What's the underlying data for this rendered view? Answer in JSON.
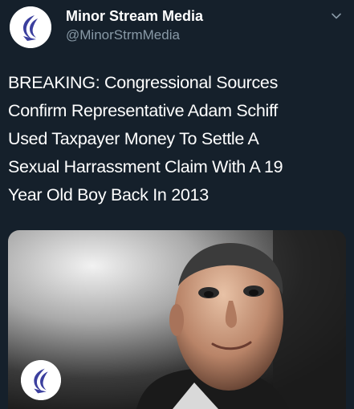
{
  "tweet": {
    "display_name": "Minor Stream Media",
    "handle": "@MinorStrmMedia",
    "text_lines": [
      "BREAKING: Congressional Sources",
      "Confirm Representative Adam Schiff",
      "Used Taxpayer Money To Settle A",
      "Sexual Harrassment Claim With A 19",
      "Year Old Boy Back In 2013"
    ]
  },
  "icons": {
    "avatar": "bird-logo-icon",
    "menu": "chevron-down-icon",
    "media_logo": "bird-logo-icon"
  },
  "colors": {
    "background": "#15202b",
    "primary_text": "#ffffff",
    "secondary_text": "#8899a6",
    "logo_blue": "#3b3f9e"
  }
}
